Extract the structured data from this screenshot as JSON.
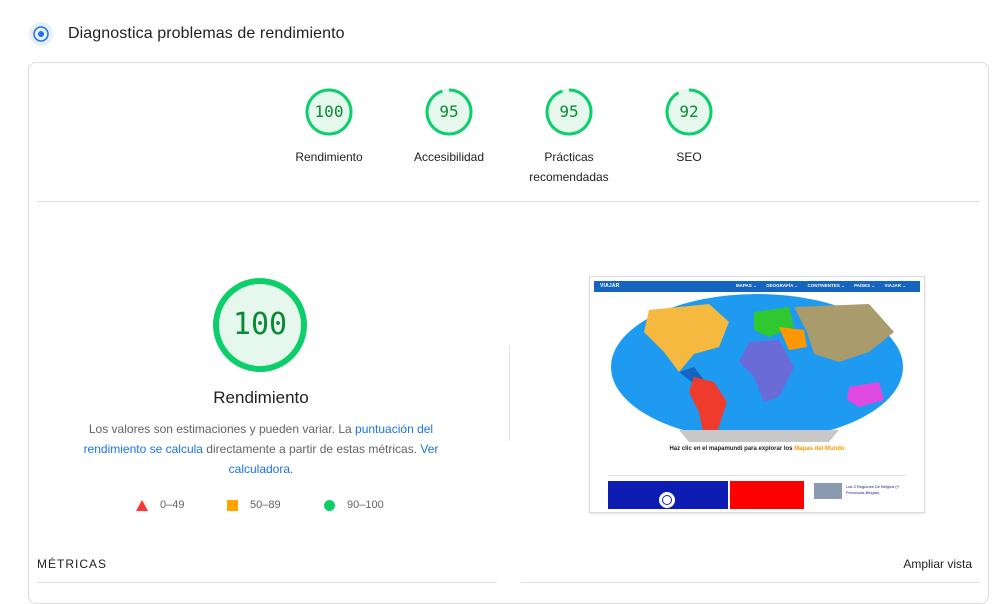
{
  "header": {
    "title": "Diagnostica problemas de rendimiento",
    "icon": "speed-icon"
  },
  "scores": [
    {
      "value": "100",
      "label": "Rendimiento"
    },
    {
      "value": "95",
      "label": "Accesibilidad"
    },
    {
      "value": "95",
      "label": "Prácticas recomendadas"
    },
    {
      "value": "92",
      "label": "SEO"
    }
  ],
  "main": {
    "score": "100",
    "title": "Rendimiento",
    "desc_part1": "Los valores son estimaciones y pueden variar. La ",
    "desc_link1": "puntuación del rendimiento se calcula",
    "desc_part2": " directamente a partir de estas métricas. ",
    "desc_link2": "Ver calculadora."
  },
  "legend": [
    {
      "range": "0–49",
      "color": "#ff3333",
      "shape": "triangle"
    },
    {
      "range": "50–89",
      "color": "#ffa400",
      "shape": "square"
    },
    {
      "range": "90–100",
      "color": "#0cce6b",
      "shape": "circle"
    }
  ],
  "screenshot": {
    "logo": "VIAJAR",
    "menu": [
      "MAPAS ⌄",
      "GEOGRAFÍA ⌄",
      "CONTINENTES ⌄",
      "PAÍSES ⌄",
      "VIAJAR ⌄"
    ],
    "continents": [
      "América del Norte",
      "Europa",
      "Asia",
      "Oriente Medio",
      "África",
      "América Central",
      "América del Sur",
      "Oceanía",
      "Antártida",
      "Caribe"
    ],
    "caption_prefix": "Haz clic en el mapamundi para explorar los ",
    "caption_link": "Mapas del Mundo",
    "thumb_text": "Las 3 Regiones De Bélgica (Y Provincias Belgas)"
  },
  "metrics": {
    "label": "MÉTRICAS",
    "expand": "Ampliar vista"
  },
  "colors": {
    "good": "#0cce6b",
    "good_text": "#0a8a32",
    "good_bg": "#e6f8ee",
    "link": "#1a73e8"
  }
}
